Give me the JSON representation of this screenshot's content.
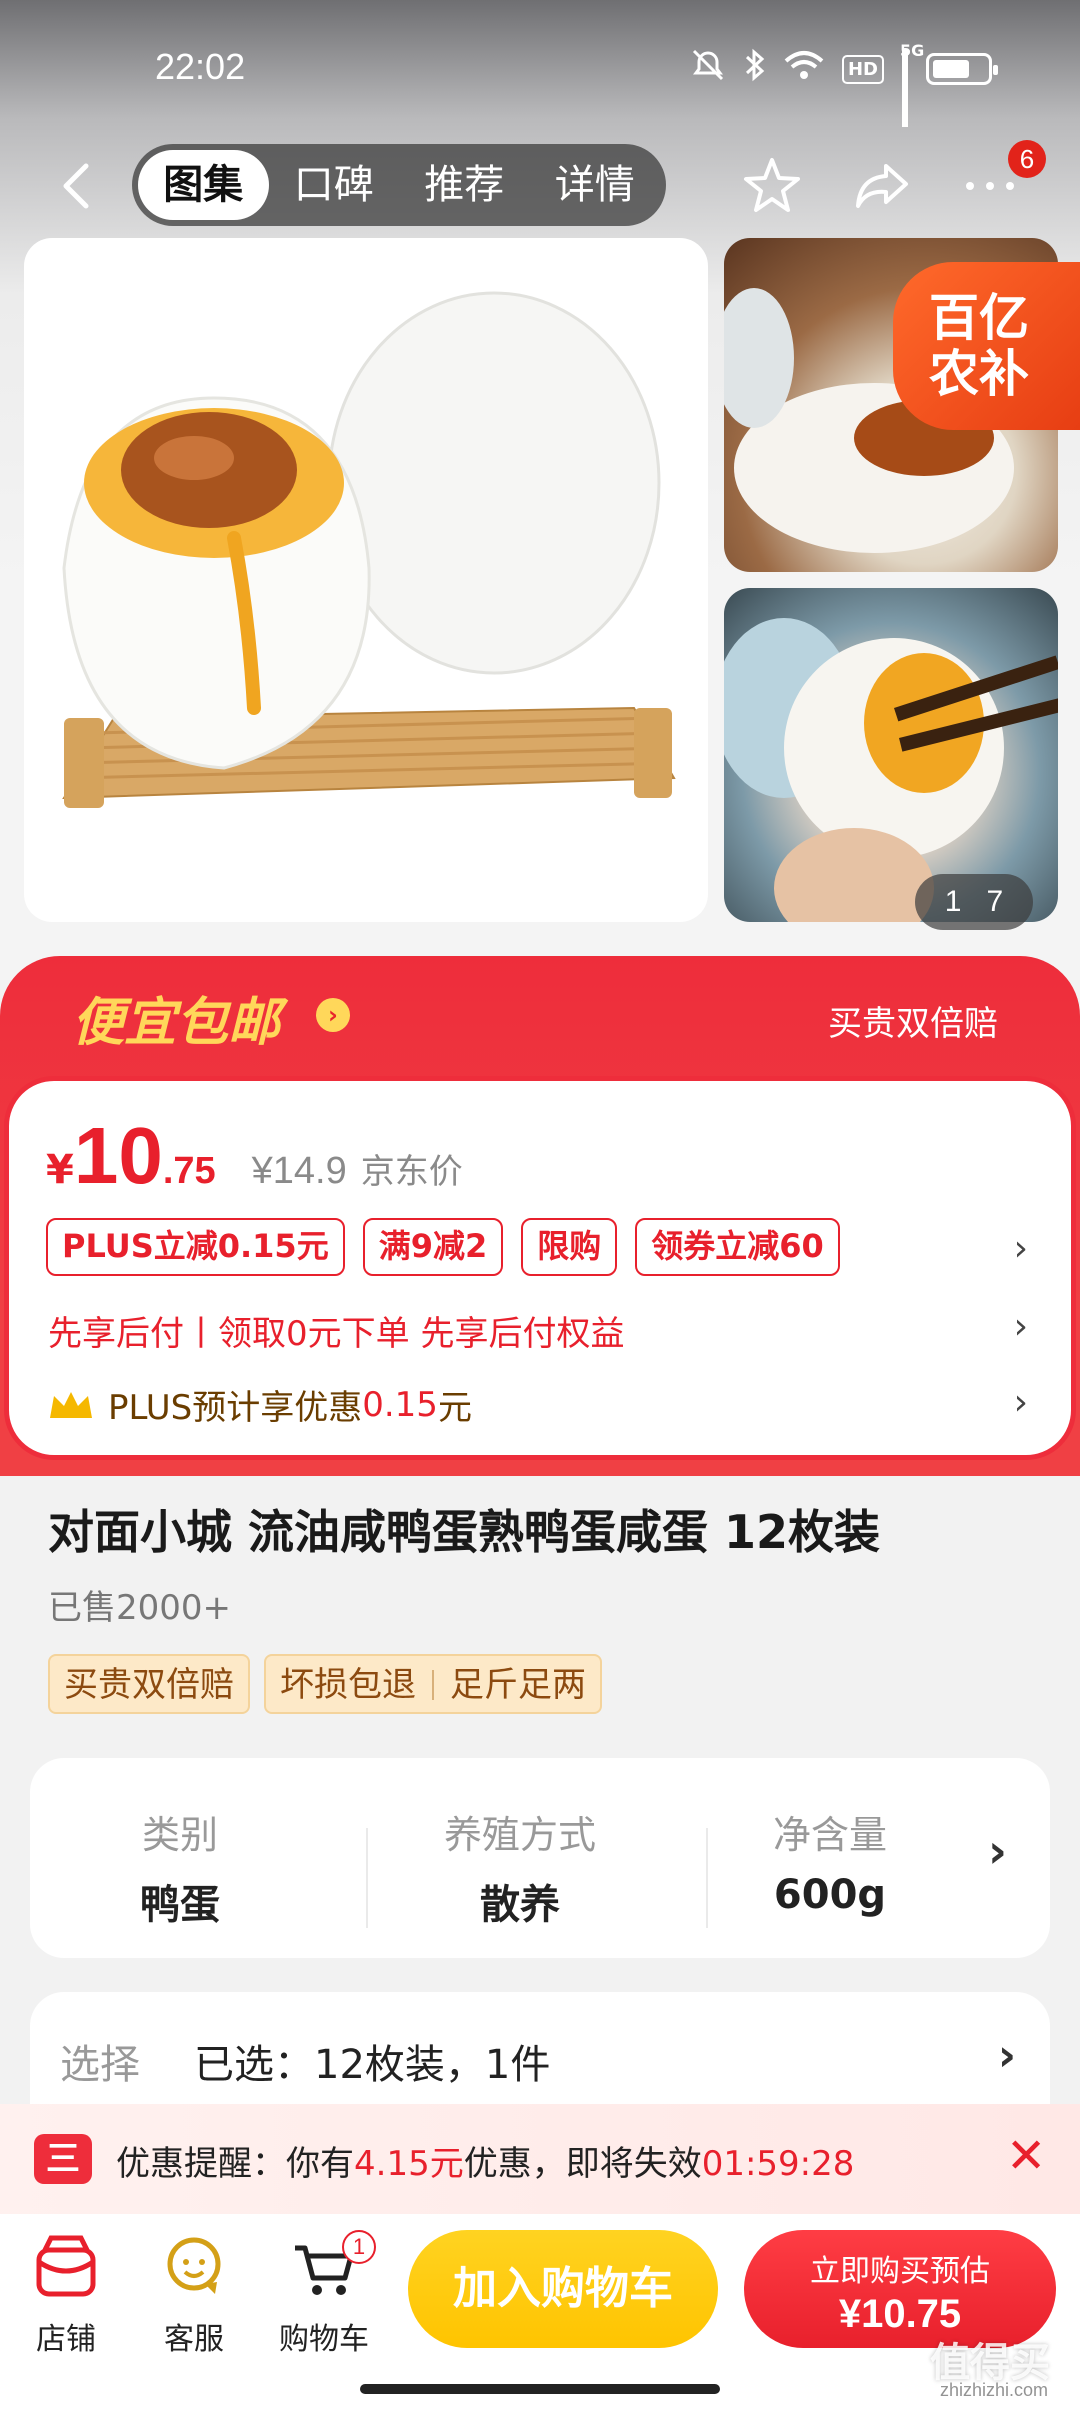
{
  "status_bar": {
    "time": "22:02",
    "network": "5G",
    "hd": "HD"
  },
  "nav": {
    "tabs": [
      "图集",
      "口碑",
      "推荐",
      "详情"
    ],
    "more_badge": "6"
  },
  "gallery": {
    "promo_tag": "百亿\n农补",
    "counter_current": "1",
    "counter_total": "7"
  },
  "banner": {
    "title": "便宜包邮",
    "arrow": "›",
    "right_text": "买贵双倍赔"
  },
  "price": {
    "yen": "¥",
    "integer": "10",
    "decimal": ".75",
    "original": "¥14.9",
    "original_label": "京东价"
  },
  "coupons": [
    "PLUS立减0.15元",
    "满9减2",
    "限购",
    "领券立减60"
  ],
  "pay_later": "先享后付丨领取0元下单 先享后付权益",
  "plus": {
    "prefix": "PLUS预计享优惠",
    "amount": "0.15",
    "suffix": "元"
  },
  "product": {
    "title": "对面小城 流油咸鸭蛋熟鸭蛋咸蛋 12枚装",
    "sold": "已售2000+",
    "tag1": "买贵双倍赔",
    "tag2a": "坏损包退",
    "tag2b": "足斤足两"
  },
  "attributes": [
    {
      "label": "类别",
      "value": "鸭蛋"
    },
    {
      "label": "养殖方式",
      "value": "散养"
    },
    {
      "label": "净含量",
      "value": "600g"
    }
  ],
  "selection": {
    "label": "选择",
    "value": "已选：12枚装，1件"
  },
  "reminder": {
    "text_a": "优惠提醒：你有",
    "amount": "4.15元",
    "text_b": "优惠，即将失效",
    "countdown": "01:59:28",
    "close": "✕"
  },
  "bottom_bar": {
    "shop": "店铺",
    "service": "客服",
    "cart": "购物车",
    "cart_badge": "1",
    "add_to_cart": "加入购物车",
    "buy_top": "立即购买预估",
    "buy_price": "¥10.75"
  },
  "watermark": {
    "main": "值得买",
    "sub": "zhizhizhi.com"
  },
  "colors": {
    "accent_red": "#e8202c",
    "banner_red": "#ee2d3b",
    "gold": "#ffd75a",
    "cart_yellow": "#ffc400"
  }
}
